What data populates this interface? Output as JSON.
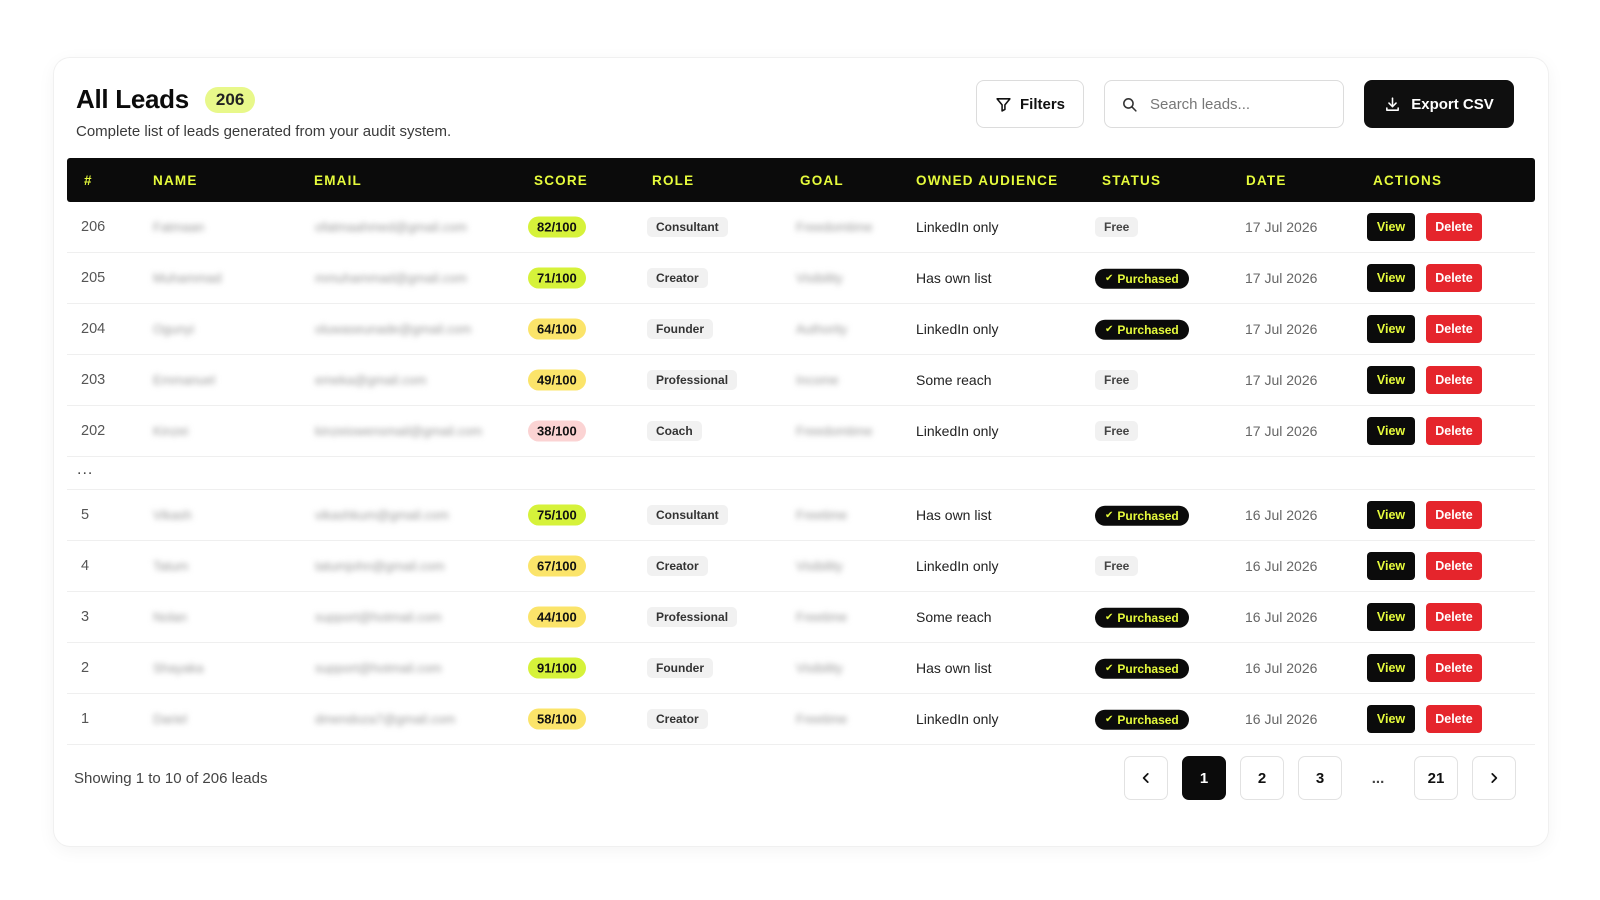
{
  "header": {
    "title": "All Leads",
    "count": "206",
    "subtitle": "Complete list of leads generated from your audit system."
  },
  "toolbar": {
    "filters_label": "Filters",
    "search_placeholder": "Search leads...",
    "export_label": "Export CSV"
  },
  "table": {
    "columns": [
      "#",
      "NAME",
      "EMAIL",
      "SCORE",
      "ROLE",
      "GOAL",
      "OWNED AUDIENCE",
      "STATUS",
      "DATE",
      "ACTIONS"
    ],
    "view_label": "View",
    "delete_label": "Delete",
    "gap_label": "...",
    "rows_top": [
      {
        "num": "206",
        "name": "Fatmaan",
        "email": "ofatmaahmed@gmail.com",
        "score": "82/100",
        "score_color": "#d6f23a",
        "role": "Consultant",
        "goal": "Freedomtime",
        "audience": "LinkedIn only",
        "status": "Free",
        "purchased": false,
        "date": "17 Jul 2026"
      },
      {
        "num": "205",
        "name": "Muhammad",
        "email": "mmuhammad@gmail.com",
        "score": "71/100",
        "score_color": "#d6f23a",
        "role": "Creator",
        "goal": "Visibility",
        "audience": "Has own list",
        "status": "Purchased",
        "purchased": true,
        "date": "17 Jul 2026"
      },
      {
        "num": "204",
        "name": "Ogunyi",
        "email": "oluwaseunade@gmail.com",
        "score": "64/100",
        "score_color": "#fbe46a",
        "role": "Founder",
        "goal": "Authority",
        "audience": "LinkedIn only",
        "status": "Purchased",
        "purchased": true,
        "date": "17 Jul 2026"
      },
      {
        "num": "203",
        "name": "Emmanuel",
        "email": "emeka@gmail.com",
        "score": "49/100",
        "score_color": "#fbe46a",
        "role": "Professional",
        "goal": "Income",
        "audience": "Some reach",
        "status": "Free",
        "purchased": false,
        "date": "17 Jul 2026"
      },
      {
        "num": "202",
        "name": "Kinzei",
        "email": "kinzeiowensmail@gmail.com",
        "score": "38/100",
        "score_color": "#fbd3d3",
        "role": "Coach",
        "goal": "Freedomtime",
        "audience": "LinkedIn only",
        "status": "Free",
        "purchased": false,
        "date": "17 Jul 2026"
      }
    ],
    "rows_bottom": [
      {
        "num": "5",
        "name": "Vikash",
        "email": "vikashkum@gmail.com",
        "score": "75/100",
        "score_color": "#d6f23a",
        "role": "Consultant",
        "goal": "Freetime",
        "audience": "Has own list",
        "status": "Purchased",
        "purchased": true,
        "date": "16 Jul 2026"
      },
      {
        "num": "4",
        "name": "Tatum",
        "email": "tatumjohn@gmail.com",
        "score": "67/100",
        "score_color": "#fbe46a",
        "role": "Creator",
        "goal": "Visibility",
        "audience": "LinkedIn only",
        "status": "Free",
        "purchased": false,
        "date": "16 Jul 2026"
      },
      {
        "num": "3",
        "name": "Nolan",
        "email": "support@hotmail.com",
        "score": "44/100",
        "score_color": "#fbe46a",
        "role": "Professional",
        "goal": "Freetime",
        "audience": "Some reach",
        "status": "Purchased",
        "purchased": true,
        "date": "16 Jul 2026"
      },
      {
        "num": "2",
        "name": "Shayaka",
        "email": "support@hotmail.com",
        "score": "91/100",
        "score_color": "#d6f23a",
        "role": "Founder",
        "goal": "Visibility",
        "audience": "Has own list",
        "status": "Purchased",
        "purchased": true,
        "date": "16 Jul 2026"
      },
      {
        "num": "1",
        "name": "Dariel",
        "email": "dmendoza7@gmail.com",
        "score": "58/100",
        "score_color": "#fbe46a",
        "role": "Creator",
        "goal": "Freetime",
        "audience": "LinkedIn only",
        "status": "Purchased",
        "purchased": true,
        "date": "16 Jul 2026"
      }
    ]
  },
  "footer": {
    "showing_text": "Showing 1 to 10 of 206 leads",
    "pages": [
      "1",
      "2",
      "3",
      "...",
      "21"
    ],
    "active_page": "1"
  },
  "colors": {
    "accent": "#e6fb3c",
    "dark": "#0b0b0b",
    "danger": "#e5252c"
  },
  "icons": {
    "filters": "funnel-icon",
    "search": "search-icon",
    "export": "download-icon",
    "prev": "chevron-left-icon",
    "next": "chevron-right-icon",
    "check": "check-icon"
  }
}
